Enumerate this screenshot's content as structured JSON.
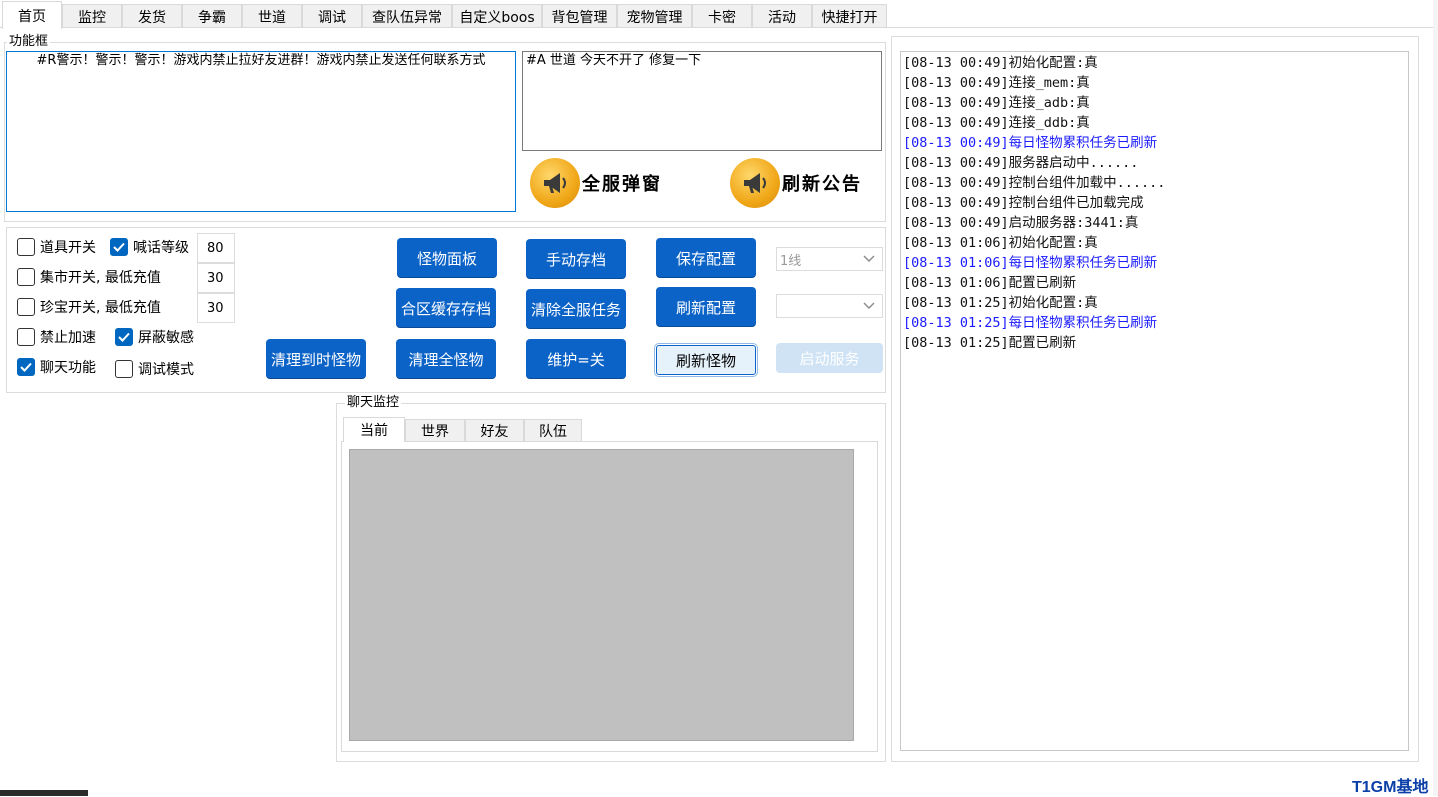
{
  "tabs": [
    {
      "label": "首页"
    },
    {
      "label": "监控"
    },
    {
      "label": "发货"
    },
    {
      "label": "争霸"
    },
    {
      "label": "世道"
    },
    {
      "label": "调试"
    },
    {
      "label": "查队伍异常"
    },
    {
      "label": "自定义boos"
    },
    {
      "label": "背包管理"
    },
    {
      "label": "宠物管理"
    },
    {
      "label": "卡密"
    },
    {
      "label": "活动"
    },
    {
      "label": "快捷打开"
    }
  ],
  "function_box": {
    "legend": "功能框",
    "broadcast_text": "#R警示！警示！警示！游戏内禁止拉好友进群！游戏内禁止发送任何联系方式",
    "notice_text": "#A 世道  今天不开了  修复一下",
    "broadcast_button": "全服弹窗",
    "notice_button": "刷新公告"
  },
  "settings": {
    "item_switch": {
      "label": "道具开关",
      "checked": false
    },
    "shout_level": {
      "label": "喊话等级",
      "checked": true,
      "value": "80"
    },
    "market": {
      "label": "集市开关, 最低充值",
      "checked": false,
      "value": "30"
    },
    "treasure": {
      "label": "珍宝开关, 最低充值",
      "checked": false,
      "value": "30"
    },
    "no_speedup": {
      "label": "禁止加速",
      "checked": false
    },
    "block_sensitive": {
      "label": "屏蔽敏感",
      "checked": true
    },
    "chat": {
      "label": "聊天功能",
      "checked": true
    },
    "debug_mode": {
      "label": "调试模式",
      "checked": false
    }
  },
  "buttons": {
    "monster_panel": "怪物面板",
    "manual_save": "手动存档",
    "save_config": "保存配置",
    "merge_save": "合区缓存存档",
    "clear_all_tasks": "清除全服任务",
    "refresh_config": "刷新配置",
    "clear_timed_monsters": "清理到时怪物",
    "clear_all_monsters": "清理全怪物",
    "maintenance": "维护=关",
    "refresh_monsters": "刷新怪物",
    "start_service": "启动服务"
  },
  "line_select": {
    "value": "1线"
  },
  "second_select": {
    "value": ""
  },
  "chat_monitor": {
    "legend": "聊天监控",
    "tabs": [
      {
        "label": "当前"
      },
      {
        "label": "世界"
      },
      {
        "label": "好友"
      },
      {
        "label": "队伍"
      }
    ]
  },
  "log": [
    {
      "text": "[08-13 00:49]初始化配置:真",
      "color": "black"
    },
    {
      "text": "[08-13 00:49]连接_mem:真",
      "color": "black"
    },
    {
      "text": "[08-13 00:49]连接_adb:真",
      "color": "black"
    },
    {
      "text": "[08-13 00:49]连接_ddb:真",
      "color": "black"
    },
    {
      "text": "[08-13 00:49]每日怪物累积任务已刷新",
      "color": "blue"
    },
    {
      "text": "[08-13 00:49]服务器启动中......",
      "color": "black"
    },
    {
      "text": "[08-13 00:49]控制台组件加载中......",
      "color": "black"
    },
    {
      "text": "[08-13 00:49]控制台组件已加载完成",
      "color": "black"
    },
    {
      "text": "[08-13 00:49]启动服务器:3441:真",
      "color": "black"
    },
    {
      "text": "[08-13 01:06]初始化配置:真",
      "color": "black"
    },
    {
      "text": "[08-13 01:06]每日怪物累积任务已刷新",
      "color": "blue"
    },
    {
      "text": "[08-13 01:06]配置已刷新",
      "color": "black"
    },
    {
      "text": "[08-13 01:25]初始化配置:真",
      "color": "black"
    },
    {
      "text": "[08-13 01:25]每日怪物累积任务已刷新",
      "color": "blue"
    },
    {
      "text": "[08-13 01:25]配置已刷新",
      "color": "black"
    }
  ],
  "watermark": "T1GM基地",
  "colors": {
    "accent": "#0c63c7",
    "log_blue": "#1a1aff",
    "watermark": "#0b3fa8"
  }
}
